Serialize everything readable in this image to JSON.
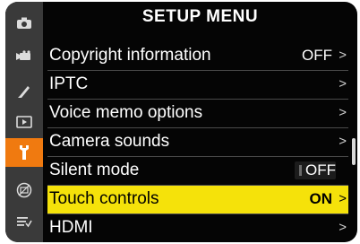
{
  "header": {
    "title": "SETUP MENU"
  },
  "sidebar": {
    "items": [
      {
        "icon": "camera-icon"
      },
      {
        "icon": "movie-camera-icon"
      },
      {
        "icon": "pencil-icon"
      },
      {
        "icon": "playback-icon"
      },
      {
        "icon": "wrench-icon",
        "active": true
      },
      {
        "icon": "retouch-icon"
      },
      {
        "icon": "my-menu-icon"
      }
    ],
    "active_color": "#f07a10"
  },
  "menu": {
    "items": [
      {
        "label": "Copyright information",
        "value": "OFF",
        "arrow": ">"
      },
      {
        "label": "IPTC",
        "value": "",
        "arrow": ">"
      },
      {
        "label": "Voice memo options",
        "value": "",
        "arrow": ">"
      },
      {
        "label": "Camera sounds",
        "value": "",
        "arrow": ">"
      },
      {
        "label": "Silent mode",
        "value": "OFF",
        "arrow": ""
      },
      {
        "label": "Touch controls",
        "value": "ON",
        "arrow": ">",
        "selected": true
      },
      {
        "label": "HDMI",
        "value": "",
        "arrow": ">"
      }
    ],
    "highlight_color": "#f5e20a"
  },
  "scrollbar": {
    "position_fraction": 0.5
  }
}
